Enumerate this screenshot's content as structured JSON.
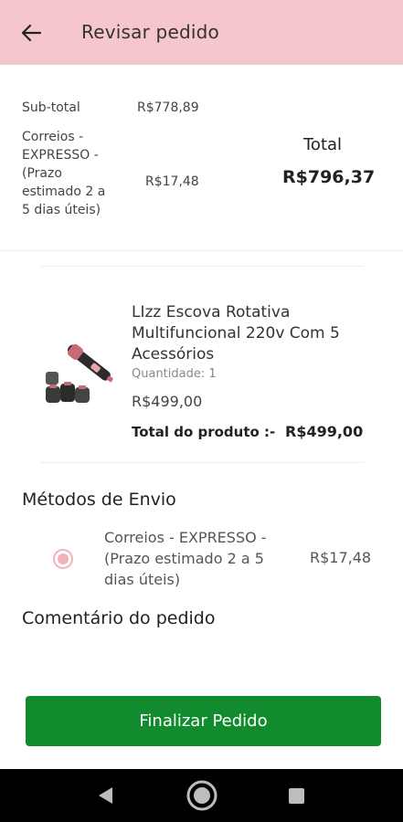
{
  "appbar": {
    "title": "Revisar pedido",
    "back_icon": "arrow-left-icon"
  },
  "summary": {
    "subtotal_label": "Sub-total",
    "subtotal_value": "R$778,89",
    "shipping_label": "Correios - EXPRESSO - (Prazo estimado 2 a 5 dias úteis)",
    "shipping_value": "R$17,48",
    "total_label": "Total",
    "total_value": "R$796,37"
  },
  "product": {
    "name": "LIzz Escova Rotativa Multifuncional 220v Com 5 Acessórios",
    "quantity": "Quantidade: 1",
    "price": "R$499,00",
    "total_label": "Total do produto :-",
    "total_value": "R$499,00"
  },
  "shipping_methods": {
    "title": "Métodos de Envio",
    "option_label": "Correios - EXPRESSO - (Prazo estimado 2 a 5 dias úteis)",
    "option_price": "R$17,48",
    "selected": true
  },
  "comment": {
    "title": "Comentário do pedido"
  },
  "footer": {
    "finalize_label": "Finalizar Pedido"
  },
  "colors": {
    "appbar": "#f5c6cb",
    "primary_button": "#128a2e",
    "radio": "#f0b3bb",
    "navbar": "#000000"
  },
  "navbar": {
    "icons": [
      "nav-back-icon",
      "nav-home-icon",
      "nav-recents-icon"
    ]
  }
}
